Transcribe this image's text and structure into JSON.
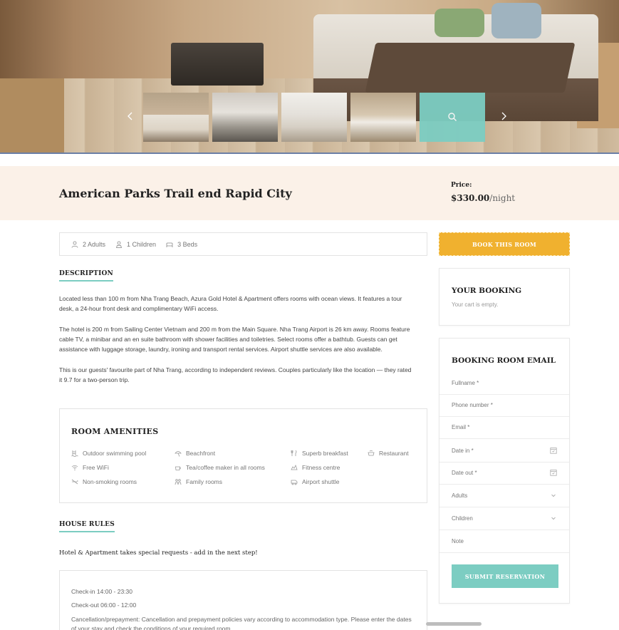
{
  "gallery": {
    "thumbnails": [
      "room-photo-1",
      "room-photo-2",
      "room-photo-3",
      "room-photo-4",
      "room-photo-5-selected"
    ],
    "prev_icon": "chevron-left-icon",
    "next_icon": "chevron-right-icon",
    "selected_icon": "search-icon",
    "overlay_color": "#7ccdc2"
  },
  "room": {
    "title": "American Parks Trail end Rapid City",
    "price_label": "Price:",
    "price": "$330.00",
    "price_unit": "/night"
  },
  "info": {
    "adults": "2 Adults",
    "children": "1 Children",
    "beds": "3 Beds"
  },
  "description": {
    "heading": "DESCRIPTION",
    "paragraphs": [
      "Located less than 100 m from Nha Trang Beach, Azura Gold Hotel & Apartment offers rooms with ocean views. It features a tour desk, a 24-hour front desk and complimentary WiFi access.",
      "The hotel is 200 m from Sailing Center Vietnam and 200 m from the Main Square. Nha Trang Airport is 26 km away. Rooms feature cable TV, a minibar and an en suite bathroom with shower facilities and toiletries. Select rooms offer a bathtub. Guests can get assistance with luggage storage, laundry, ironing and transport rental services. Airport shuttle services are also available.",
      "This is our guests' favourite part of Nha Trang, according to independent reviews. Couples particularly like the location — they rated it 9.7 for a two-person trip."
    ]
  },
  "amenities": {
    "heading": "ROOM AMENITIES",
    "items": [
      "Outdoor swimming pool",
      "Beachfront",
      "Superb breakfast",
      "Restaurant",
      "Free WiFi",
      "Tea/coffee maker in all rooms",
      "Fitness centre",
      "Non-smoking rooms",
      "Family rooms",
      "Airport shuttle"
    ]
  },
  "house_rules": {
    "heading": "HOUSE RULES",
    "subtitle": "Hotel & Apartment takes special requests - add in the next step!",
    "checkin": "Check-in 14:00 - 23:30",
    "checkout": "Check-out 06:00 - 12:00",
    "cancellation": "Cancellation/prepayment: Cancellation and prepayment policies vary according to accommodation type. Please enter the dates of your stay and check the conditions of your required room."
  },
  "sidebar": {
    "book_button": "BOOK THIS ROOM",
    "booking_title": "YOUR BOOKING",
    "cart_empty": "Your cart is empty.",
    "form_title": "BOOKING ROOM EMAIL",
    "fields": {
      "fullname": "Fullname *",
      "phone": "Phone number *",
      "email": "Email *",
      "date_in": "Date in *",
      "date_out": "Date out *",
      "adults": "Adults",
      "children": "Children",
      "note": "Note"
    },
    "submit": "SUBMIT RESERVATION"
  },
  "colors": {
    "accent": "#7ccdc2",
    "book_button": "#f0b12f",
    "title_band": "#fbf1e8"
  }
}
